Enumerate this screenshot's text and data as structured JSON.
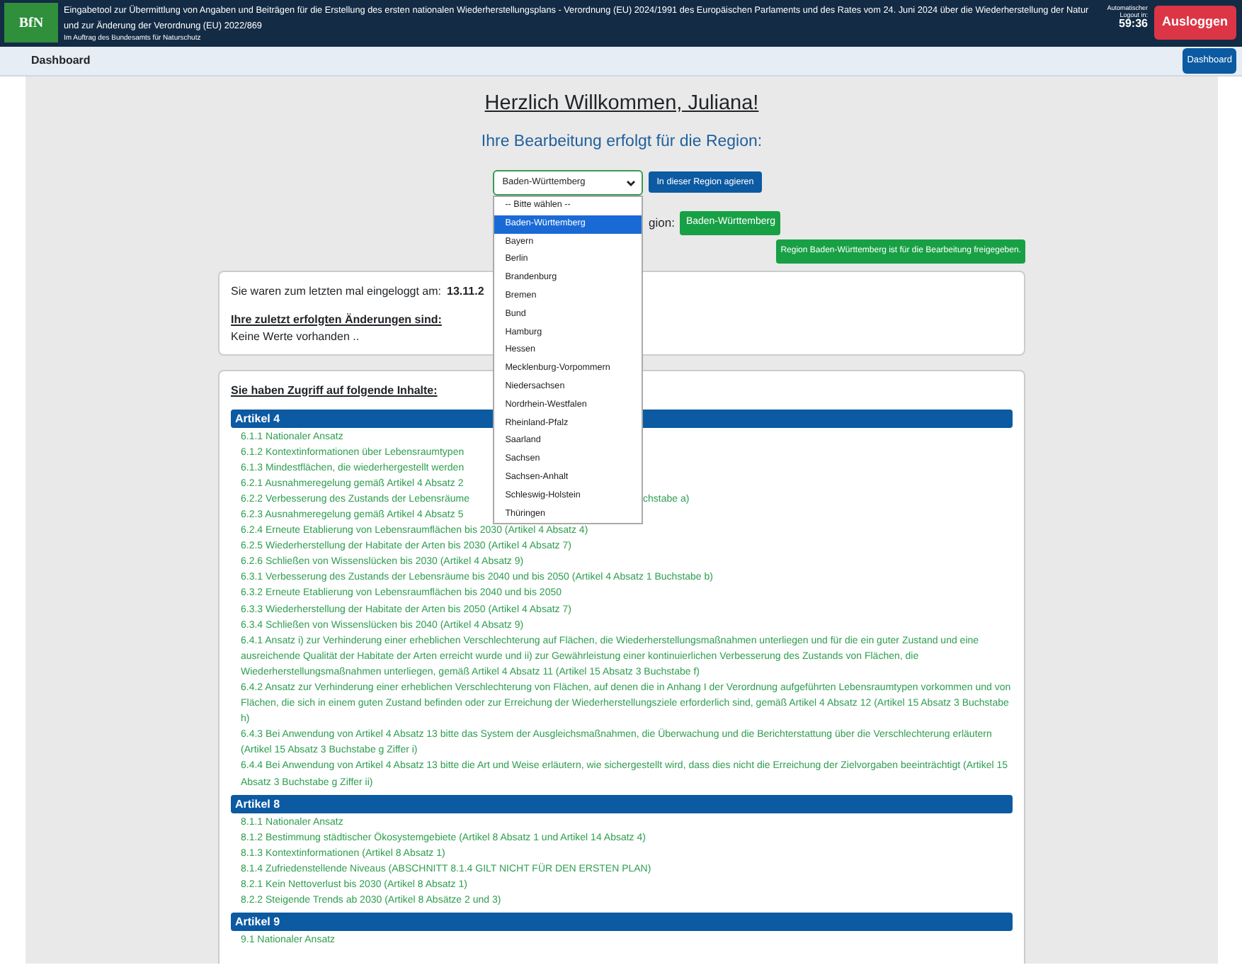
{
  "header": {
    "logo": "BfN",
    "title": "Eingabetool zur Übermittlung von Angaben und Beiträgen für die Erstellung des ersten nationalen Wiederherstellungsplans - Verordnung (EU) 2024/1991 des Europäischen Parlaments und des Rates vom 24. Juni 2024 über die Wiederherstellung der Natur und zur Änderung der Verordnung (EU) 2022/869",
    "subtitle": "Im Auftrag des Bundesamts für Naturschutz",
    "logout_label": "Automatischer Logout in:",
    "timer": "59:36",
    "logout_button": "Ausloggen"
  },
  "subbar": {
    "title": "Dashboard",
    "button": "Dashboard"
  },
  "welcome": "Herzlich Willkommen, Juliana!",
  "region_prompt": "Ihre Bearbeitung erfolgt für die Region:",
  "region_select": {
    "value": "Baden-Württemberg",
    "expanded": true,
    "action_button": "In dieser Region agieren",
    "options": [
      {
        "label": "-- Bitte wählen --",
        "selected": false
      },
      {
        "label": "Baden-Württemberg",
        "selected": true
      },
      {
        "label": "Bayern",
        "selected": false
      },
      {
        "label": "Berlin",
        "selected": false
      },
      {
        "label": "Brandenburg",
        "selected": false
      },
      {
        "label": "Bremen",
        "selected": false
      },
      {
        "label": "Bund",
        "selected": false
      },
      {
        "label": "Hamburg",
        "selected": false
      },
      {
        "label": "Hessen",
        "selected": false
      },
      {
        "label": "Mecklenburg-Vorpommern",
        "selected": false
      },
      {
        "label": "Niedersachsen",
        "selected": false
      },
      {
        "label": "Nordrhein-Westfalen",
        "selected": false
      },
      {
        "label": "Rheinland-Pfalz",
        "selected": false
      },
      {
        "label": "Saarland",
        "selected": false
      },
      {
        "label": "Sachsen",
        "selected": false
      },
      {
        "label": "Sachsen-Anhalt",
        "selected": false
      },
      {
        "label": "Schleswig-Holstein",
        "selected": false
      },
      {
        "label": "Thüringen",
        "selected": false
      }
    ]
  },
  "current_region": {
    "label": "gion:",
    "badge": "Baden-Württemberg"
  },
  "release_notice": "Region Baden-Württemberg ist für die Bearbeitung freigegeben.",
  "login_card": {
    "label": "Sie waren zum letzten mal eingeloggt am:",
    "date": "13.11.2",
    "changes_heading": "Ihre zuletzt erfolgten Änderungen sind:",
    "changes_text": "Keine Werte vorhanden .."
  },
  "access_card": {
    "heading": "Sie haben Zugriff auf folgende Inhalte:",
    "sections": [
      {
        "title": "Artikel 4",
        "items": [
          {
            "text": "6.1.1 Nationaler Ansatz"
          },
          {
            "text": "6.1.2 Kontextinformationen über Lebensraumtypen"
          },
          {
            "text": "6.1.3 Mindestflächen, die wiederhergestellt werden"
          },
          {
            "text": "6.2.1 Ausnahmeregelung gemäß Artikel 4 Absatz 2"
          },
          {
            "text": "6.2.2 Verbesserung des Zustands der Lebensräume",
            "tail": "chstabe a)"
          },
          {
            "text": "6.2.3 Ausnahmeregelung gemäß Artikel 4 Absatz 5"
          },
          {
            "text": "6.2.4 Erneute Etablierung von Lebensraumflächen bis 2030 (Artikel 4 Absatz 4)"
          },
          {
            "text": "6.2.5 Wiederherstellung der Habitate der Arten bis 2030 (Artikel 4 Absatz 7)"
          },
          {
            "text": "6.2.6 Schließen von Wissenslücken bis 2030 (Artikel 4 Absatz 9)"
          },
          {
            "text": "6.3.1 Verbesserung des Zustands der Lebensräume bis 2040 und bis 2050 (Artikel 4 Absatz 1 Buchstabe b)"
          },
          {
            "text": "6.3.2 Erneute Etablierung von Lebensraumflächen bis 2040 und bis 2050"
          },
          {
            "text": "6.3.3 Wiederherstellung der Habitate der Arten bis 2050 (Artikel 4 Absatz 7)"
          },
          {
            "text": "6.3.4 Schließen von Wissenslücken bis 2040 (Artikel 4 Absatz 9)"
          },
          {
            "text": "6.4.1 Ansatz i) zur Verhinderung einer erheblichen Verschlechterung auf Flächen, die Wiederherstellungsmaßnahmen unterliegen und für die ein guter Zustand und eine ausreichende Qualität der Habitate der Arten erreicht wurde und ii) zur Gewährleistung einer kontinuierlichen Verbesserung des Zustands von Flächen, die Wiederherstellungsmaßnahmen unterliegen, gemäß Artikel 4 Absatz 11 (Artikel 15 Absatz 3 Buchstabe f)"
          },
          {
            "text": "6.4.2 Ansatz zur Verhinderung einer erheblichen Verschlechterung von Flächen, auf denen die in Anhang I der Verordnung aufgeführten Lebensraumtypen vorkommen und von Flächen, die sich in einem guten Zustand befinden oder zur Erreichung der Wiederherstellungsziele erforderlich sind, gemäß Artikel 4 Absatz 12 (Artikel 15 Absatz 3 Buchstabe h)"
          },
          {
            "text": "6.4.3 Bei Anwendung von Artikel 4 Absatz 13 bitte das System der Ausgleichsmaßnahmen, die Überwachung und die Berichterstattung über die Verschlechterung erläutern (Artikel 15 Absatz 3 Buchstabe g Ziffer i)"
          },
          {
            "text": "6.4.4 Bei Anwendung von Artikel 4 Absatz 13 bitte die Art und Weise erläutern, wie sichergestellt wird, dass dies nicht die Erreichung der Zielvorgaben beeinträchtigt (Artikel 15 Absatz 3 Buchstabe g Ziffer ii)"
          }
        ]
      },
      {
        "title": "Artikel 8",
        "items": [
          {
            "text": "8.1.1 Nationaler Ansatz"
          },
          {
            "text": "8.1.2 Bestimmung städtischer Ökosystemgebiete (Artikel 8 Absatz 1 und Artikel 14 Absatz 4)"
          },
          {
            "text": "8.1.3 Kontextinformationen (Artikel 8 Absatz 1)"
          },
          {
            "text": "8.1.4 Zufriedenstellende Niveaus (ABSCHNITT 8.1.4 GILT NICHT FÜR DEN ERSTEN PLAN)"
          },
          {
            "text": "8.2.1 Kein Nettoverlust bis 2030 (Artikel 8 Absatz 1)"
          },
          {
            "text": "8.2.2 Steigende Trends ab 2030 (Artikel 8 Absätze 2 und 3)"
          }
        ]
      },
      {
        "title": "Artikel 9",
        "items": [
          {
            "text": "9.1 Nationaler Ansatz"
          }
        ]
      }
    ]
  }
}
